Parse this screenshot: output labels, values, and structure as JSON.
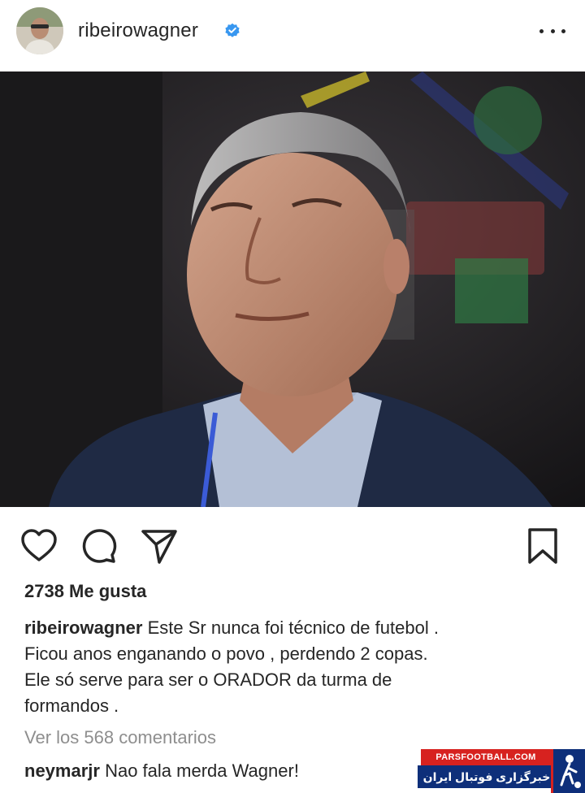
{
  "post": {
    "username": "ribeirowagner",
    "likes_text": "2738 Me gusta",
    "caption": {
      "user": "ribeirowagner",
      "line1": "Este Sr nunca foi técnico de futebol .",
      "line2": "Ficou anos enganando o povo , perdendo 2 copas.",
      "line3": "Ele só serve para ser o ORADOR da turma de",
      "line4": "formandos ."
    },
    "view_comments": "Ver los 568 comentarios",
    "comment": {
      "user": "neymarjr",
      "text": "Nao fala merda Wagner!"
    }
  },
  "icons": {
    "verified": "verified-badge-icon",
    "more": "more-options-icon",
    "like": "heart-icon",
    "comment": "comment-bubble-icon",
    "share": "paper-plane-icon",
    "save": "bookmark-icon"
  },
  "watermark": {
    "top": "PARSFOOTBALL.COM",
    "bottom": "خبرگزاری فوتبال ایران"
  },
  "colors": {
    "verified_blue": "#3897f0",
    "text": "#262626",
    "muted": "#8e8e8e",
    "watermark_red": "#d7221f",
    "watermark_blue": "#0e2f7a"
  }
}
